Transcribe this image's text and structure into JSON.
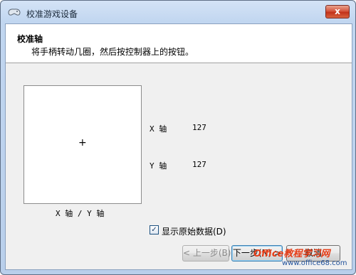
{
  "window": {
    "title": "校准游戏设备",
    "close_label": "x"
  },
  "header": {
    "title": "校准轴",
    "description": "将手柄转动几圈，然后按控制器上的按钮。"
  },
  "axes": {
    "box_label": "X 轴 / Y 轴",
    "crosshair": "+",
    "x": {
      "label": "X 轴",
      "value": "127"
    },
    "y": {
      "label": "Y 轴",
      "value": "127"
    }
  },
  "checkbox": {
    "label": "显示原始数据(D)",
    "checked": true,
    "mark": "✓"
  },
  "buttons": {
    "back": "< 上一步(B)",
    "next": "下一步(N) >",
    "cancel": "取消"
  },
  "watermark": {
    "brand": "Office教程学习网",
    "url": "www.office68.com"
  }
}
